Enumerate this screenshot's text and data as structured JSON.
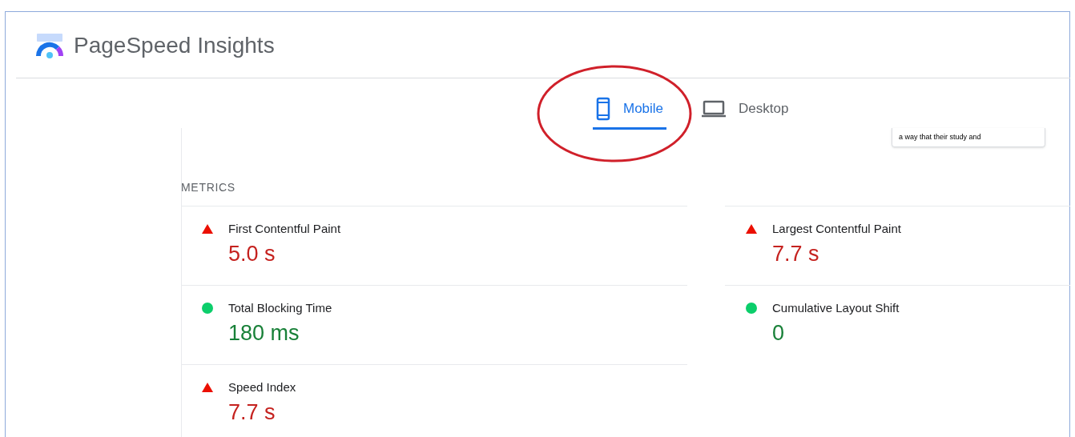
{
  "app": {
    "title": "PageSpeed Insights"
  },
  "tabs": [
    {
      "label": "Mobile",
      "kind": "mobile",
      "selected": true
    },
    {
      "label": "Desktop",
      "kind": "desktop",
      "selected": false
    }
  ],
  "preview": {
    "text": "a way that their study and"
  },
  "metrics": {
    "heading": "METRICS",
    "items": [
      {
        "label": "First Contentful Paint",
        "value": "5.0 s",
        "kind": "fail"
      },
      {
        "label": "Largest Contentful Paint",
        "value": "7.7 s",
        "kind": "fail"
      },
      {
        "label": "Total Blocking Time",
        "value": "180 ms",
        "kind": "pass"
      },
      {
        "label": "Cumulative Layout Shift",
        "value": "0",
        "kind": "pass"
      },
      {
        "label": "Speed Index",
        "value": "7.7 s",
        "kind": "fail"
      }
    ]
  }
}
